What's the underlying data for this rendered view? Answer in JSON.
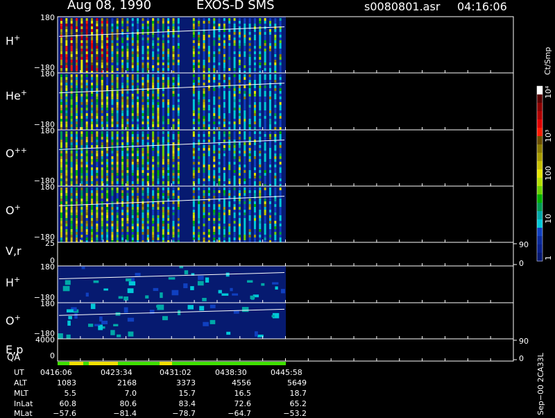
{
  "header": {
    "date": "Aug 08, 1990",
    "mission": "EXOS-D SMS",
    "file": "s0080801.asr",
    "time": "04:16:06"
  },
  "panels": [
    {
      "label": "H",
      "sup": "+",
      "ymax": "180",
      "ymin": "−180"
    },
    {
      "label": "He",
      "sup": "+",
      "ymax": "180",
      "ymin": "−180"
    },
    {
      "label": "O",
      "sup": "++",
      "ymax": "180",
      "ymin": "−180"
    },
    {
      "label": "O",
      "sup": "+",
      "ymax": "180",
      "ymin": "−180"
    },
    {
      "label": "V,r",
      "sup": "",
      "ymax": "25",
      "ymin": "0",
      "rmax": "90",
      "rmin": "0"
    },
    {
      "label": "H",
      "sup": "+",
      "ymax": "180",
      "ymin": "−180"
    },
    {
      "label": "O",
      "sup": "+",
      "ymax": "180",
      "ymin": "−180"
    },
    {
      "label": "E,p",
      "sup": "",
      "ymax": "4000",
      "ymin": "0",
      "rmax": "90",
      "rmin": "0"
    }
  ],
  "qa_label": "QA",
  "colorbar": {
    "unit": "Ct/Smp",
    "ticks": [
      "10⁴",
      "10³",
      "100",
      "10",
      "1"
    ],
    "colors": [
      "#ffffff",
      "#5a0000",
      "#8b0000",
      "#b00000",
      "#e00000",
      "#ff1a00",
      "#6b4f00",
      "#8a7a00",
      "#a89b00",
      "#c8c000",
      "#e6e600",
      "#b5e000",
      "#6ad000",
      "#00b000",
      "#009a50",
      "#00a8a8",
      "#00c8d8",
      "#1040c0",
      "#0a2a9a",
      "#08208a",
      "#061870"
    ]
  },
  "footer": {
    "row_labels": [
      "UT",
      "ALT",
      "MLT",
      "InLat",
      "MLat"
    ],
    "columns": [
      [
        "0416:06",
        "1083",
        "5.5",
        "60.8",
        "−57.6"
      ],
      [
        "0423:34",
        "2168",
        "7.0",
        "80.6",
        "−81.4"
      ],
      [
        "0431:02",
        "3373",
        "15.7",
        "83.4",
        "−78.7"
      ],
      [
        "0438:30",
        "4556",
        "16.5",
        "72.6",
        "−64.7"
      ],
      [
        "0445:58",
        "5649",
        "18.7",
        "65.2",
        "−53.2"
      ]
    ]
  },
  "side_note": "Sep−00  2CA33L",
  "chart_data": {
    "type": "heatmap",
    "title": "Aug 08, 1990   EXOS-D SMS",
    "x_tick_labels": [
      "0416:06",
      "0423:34",
      "0431:02",
      "0438:30",
      "0445:58"
    ],
    "series": [
      {
        "name": "H+",
        "ylim": [
          -180,
          180
        ]
      },
      {
        "name": "He+",
        "ylim": [
          -180,
          180
        ]
      },
      {
        "name": "O++",
        "ylim": [
          -180,
          180
        ]
      },
      {
        "name": "O+",
        "ylim": [
          -180,
          180
        ]
      },
      {
        "name": "V,r",
        "ylim": [
          0,
          25
        ],
        "right_ylim": [
          0,
          90
        ]
      },
      {
        "name": "H+",
        "ylim": [
          -180,
          180
        ]
      },
      {
        "name": "O+",
        "ylim": [
          -180,
          180
        ]
      },
      {
        "name": "E,p",
        "ylim": [
          0,
          4000
        ],
        "right_ylim": [
          0,
          90
        ]
      }
    ],
    "colorbar_unit": "Ct/Smp",
    "colorbar_range": [
      1,
      10000
    ],
    "colorbar_scale": "log"
  }
}
